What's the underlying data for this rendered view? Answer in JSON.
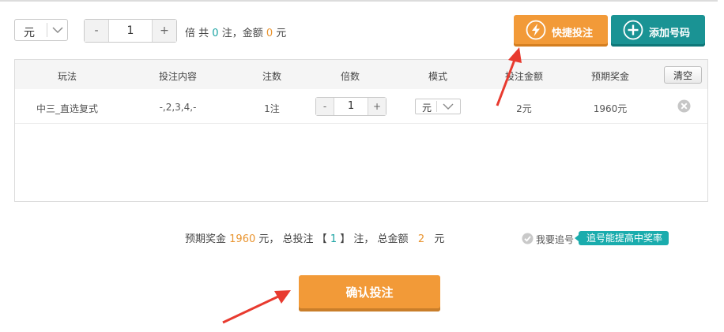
{
  "unit_select": {
    "value": "元"
  },
  "multiplier": {
    "minus": "-",
    "value": "1",
    "plus": "+"
  },
  "top_summary": {
    "prefix": "倍 共",
    "bets": "0",
    "bets_unit": "注，金额",
    "amount": "0",
    "amount_unit": "元"
  },
  "actions": {
    "quick_bet": "快捷投注",
    "add_number": "添加号码"
  },
  "table": {
    "headers": [
      "玩法",
      "投注内容",
      "注数",
      "倍数",
      "模式",
      "投注金额",
      "预期奖金"
    ],
    "clear_label": "清空",
    "rows": [
      {
        "play": "中三_直选复式",
        "content": "-,2,3,4,-",
        "bets": "1注",
        "multiple": "1",
        "mode": "元",
        "amount": "2元",
        "prize": "1960元"
      }
    ]
  },
  "bottom_summary": {
    "prize_label": "预期奖金",
    "prize_value": "1960",
    "prize_unit": "元，",
    "total_bets_label": "总投注 【",
    "total_bets_value": "1",
    "total_bets_unit": "】 注，",
    "total_amount_label": "总金额",
    "total_amount_value": "2",
    "total_amount_unit": "元"
  },
  "chase": {
    "label": "我要追号",
    "tag": "追号能提高中奖率",
    "checked": false
  },
  "confirm": {
    "label": "确认投注"
  },
  "colors": {
    "orange": "#f29a38",
    "teal": "#1a9394",
    "highlight_teal": "#1aa3a3",
    "highlight_orange": "#e9942f",
    "arrow_red": "#e83a2f"
  }
}
